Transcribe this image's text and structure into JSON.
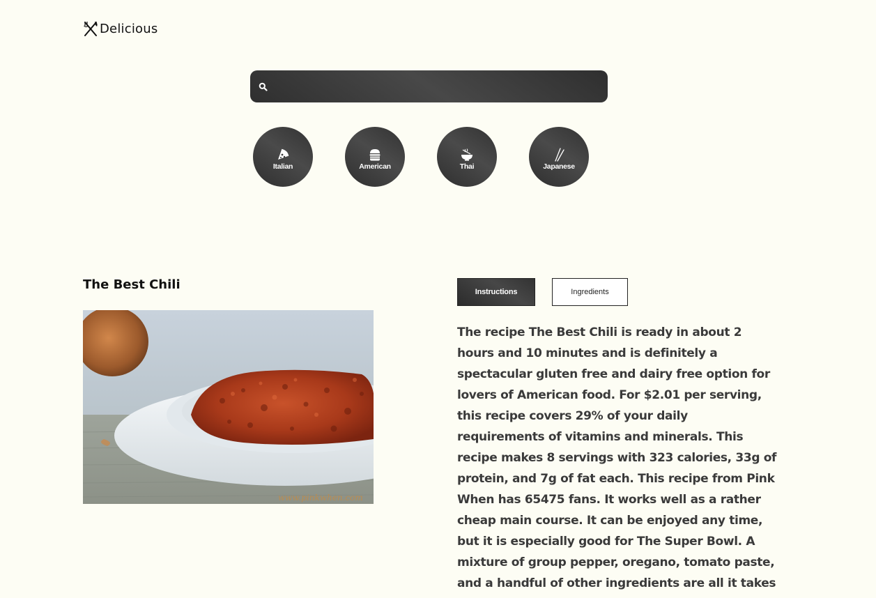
{
  "logo": {
    "text": "Delicious",
    "icon": "fork-knife-icon"
  },
  "search": {
    "icon": "search-icon",
    "value": "",
    "placeholder": ""
  },
  "cuisines": [
    {
      "label": "Italian",
      "icon": "pizza-icon"
    },
    {
      "label": "American",
      "icon": "burger-icon"
    },
    {
      "label": "Thai",
      "icon": "noodle-bowl-icon"
    },
    {
      "label": "Japanese",
      "icon": "chopsticks-icon"
    }
  ],
  "recipe": {
    "title": "The Best Chili",
    "image_watermark": "www.pinkwhen.com",
    "tabs": {
      "instructions": "Instructions",
      "ingredients": "Ingredients",
      "active": "instructions"
    },
    "summary": "The recipe The Best Chili is ready in about 2 hours and 10 minutes and is definitely a spectacular gluten free and dairy free option for lovers of American food. For $2.01 per serving, this recipe covers 29% of your daily requirements of vitamins and minerals. This recipe makes 8 servings with 323 calories, 33g of protein, and 7g of fat each. This recipe from Pink When has 65475 fans. It works well as a rather cheap main course. It can be enjoyed any time, but it is especially good for The Super Bowl. A mixture of group pepper, oregano, tomato paste, and a handful of other ingredients are all it takes to"
  },
  "colors": {
    "background": "#fdfdf4",
    "dark": "#333333",
    "text": "#3a3a3a"
  }
}
